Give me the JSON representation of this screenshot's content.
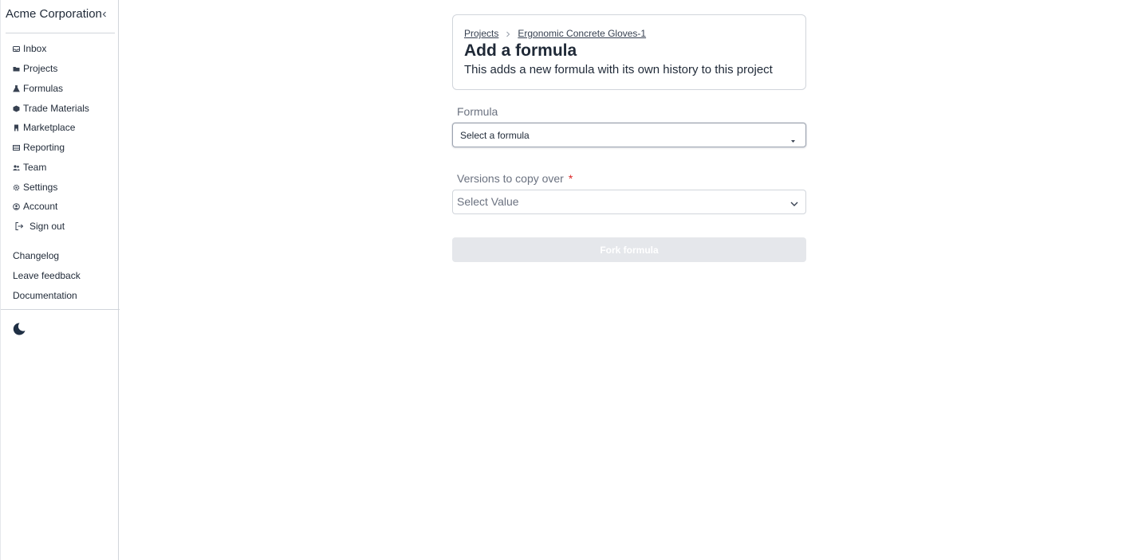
{
  "sidebar": {
    "org_name": "Acme Corporation",
    "collapse_icon": "chevron-left-icon",
    "nav_items": [
      {
        "label": "Inbox",
        "icon": "inbox-icon"
      },
      {
        "label": "Projects",
        "icon": "folder-icon"
      },
      {
        "label": "Formulas",
        "icon": "flask-icon"
      },
      {
        "label": "Trade Materials",
        "icon": "cube-icon"
      },
      {
        "label": "Marketplace",
        "icon": "store-icon"
      },
      {
        "label": "Reporting",
        "icon": "table-icon"
      },
      {
        "label": "Team",
        "icon": "users-icon"
      },
      {
        "label": "Settings",
        "icon": "gear-icon"
      },
      {
        "label": "Account",
        "icon": "user-circle-icon"
      },
      {
        "label": "Sign out",
        "icon": "sign-out-icon"
      }
    ],
    "secondary_links": [
      {
        "label": "Changelog"
      },
      {
        "label": "Leave feedback"
      },
      {
        "label": "Documentation"
      }
    ],
    "theme_toggle_icon": "moon-icon"
  },
  "header": {
    "breadcrumb": [
      {
        "label": "Projects"
      },
      {
        "label": "Ergonomic Concrete Gloves-1"
      }
    ],
    "title": "Add a formula",
    "subtitle": "This adds a new formula with its own history to this project"
  },
  "form": {
    "formula_label": "Formula",
    "formula_value": "Select a formula",
    "versions_label": "Versions to copy over",
    "versions_required_mark": "*",
    "versions_placeholder": "Select Value",
    "submit_label": "Fork formula"
  },
  "colors": {
    "sidebar_border": "#d1d5db",
    "button_disabled_bg": "#e5e7eb",
    "required": "#dc2626"
  }
}
